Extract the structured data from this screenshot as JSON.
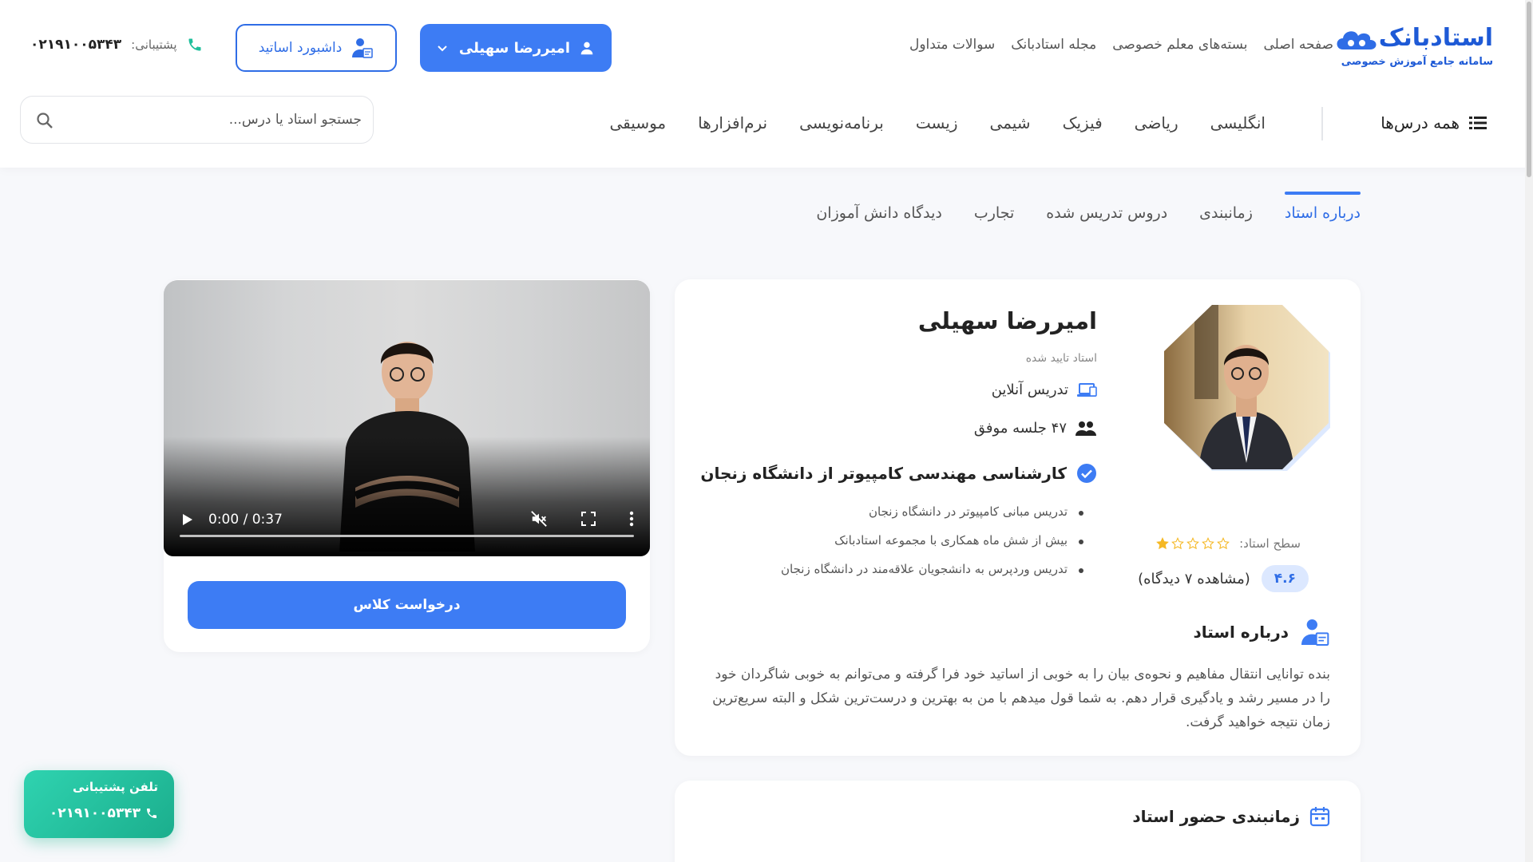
{
  "logo": {
    "title": "استادبانک",
    "subtitle": "سامانه جامع آموزش خصوصی"
  },
  "topnav": [
    "صفحه اصلی",
    "بسته‌های معلم خصوصی",
    "مجله استادبانک",
    "سوالات متداول"
  ],
  "user_button": {
    "name": "امیررضا سهیلی"
  },
  "dashboard_button": {
    "label": "داشبورد اساتید"
  },
  "support_top": {
    "label": "پشتیبانی:",
    "number": "۰۲۱۹۱۰۰۵۳۴۳"
  },
  "all_courses": "همه درس‌ها",
  "categories": [
    "انگلیسی",
    "ریاضی",
    "فیزیک",
    "شیمی",
    "زیست",
    "برنامه‌نویسی",
    "نرم‌افزارها",
    "موسیقی"
  ],
  "search": {
    "placeholder": "جستجو استاد یا درس..."
  },
  "tabs": [
    "درباره استاد",
    "زمانبندی",
    "دروس تدریس شده",
    "تجارب",
    "دیدگاه دانش آموزان"
  ],
  "teacher": {
    "name": "امیررضا سهیلی",
    "verified": "استاد تایید شده",
    "online": "تدریس آنلاین",
    "sessions": "۴۷ جلسه موفق",
    "degree": "کارشناسی مهندسی کامپیوتر از دانشگاه زنجان",
    "bullets": [
      "تدریس مبانی کامپیوتر در دانشگاه زنجان",
      "بیش از شش ماه همکاری با مجموعه استادبانک",
      "تدریس وردپرس به دانشجویان علاقه‌مند در دانشگاه زنجان"
    ],
    "level_label": "سطح استاد:",
    "level_stars": 1,
    "level_max": 5,
    "rating": "۴.۶",
    "reviews": "(مشاهده ۷ دیدگاه)",
    "about_title": "درباره استاد",
    "about_text": "بنده توانایی انتقال مفاهیم و نحوه‌ی بیان را به خوبی از اساتید خود فرا گرفته و می‌توانم به خوبی شاگردان خود را در مسیر رشد و یادگیری قرار دهم. به شما قول میدهم با من به بهترین و درست‌ترین شکل و البته سریع‌ترین زمان نتیجه خواهید گرفت."
  },
  "video": {
    "time": "0:00 / 0:37"
  },
  "request_button": "درخواست کلاس",
  "schedule": {
    "title": "زمانبندی حضور استاد"
  },
  "support_float": {
    "label": "تلفن پشتیبانی",
    "number": "۰۲۱۹۱۰۰۵۳۴۳"
  },
  "colors": {
    "primary": "#3d7cf4",
    "support": "#1fbf9c",
    "star": "#f5b824"
  }
}
